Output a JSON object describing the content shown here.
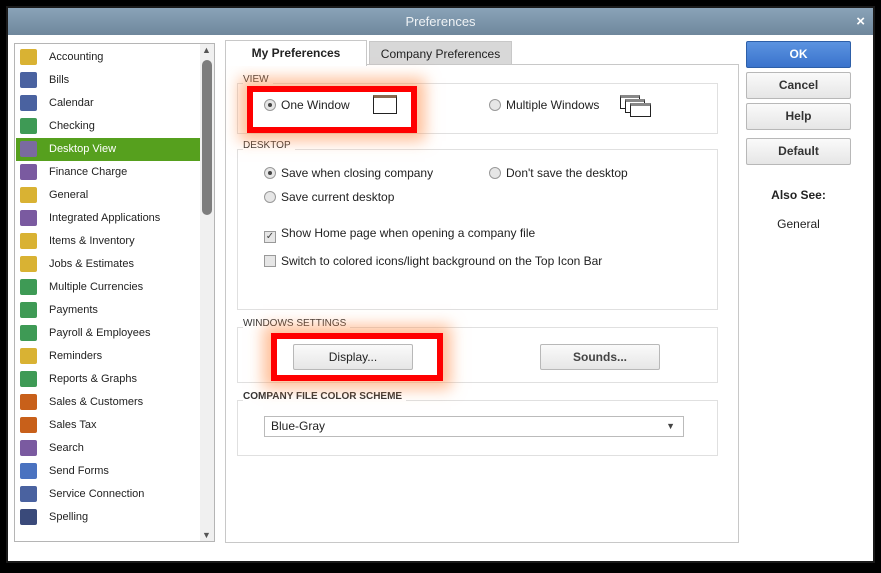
{
  "window": {
    "title": "Preferences",
    "close": "×"
  },
  "sidebar": {
    "items": [
      {
        "label": "Accounting",
        "icon": "accounting-icon",
        "color": "#d9b233"
      },
      {
        "label": "Bills",
        "icon": "bills-icon",
        "color": "#4a62a0"
      },
      {
        "label": "Calendar",
        "icon": "calendar-icon",
        "color": "#4a62a0"
      },
      {
        "label": "Checking",
        "icon": "checking-icon",
        "color": "#3e9a55"
      },
      {
        "label": "Desktop View",
        "icon": "desktop-view-icon",
        "color": "#7a6aa0",
        "selected": true
      },
      {
        "label": "Finance Charge",
        "icon": "finance-charge-icon",
        "color": "#7a5aa0"
      },
      {
        "label": "General",
        "icon": "general-icon",
        "color": "#d9b233"
      },
      {
        "label": "Integrated Applications",
        "icon": "integrated-apps-icon",
        "color": "#7a5aa0"
      },
      {
        "label": "Items & Inventory",
        "icon": "items-inventory-icon",
        "color": "#d9b233"
      },
      {
        "label": "Jobs & Estimates",
        "icon": "jobs-estimates-icon",
        "color": "#d9b233"
      },
      {
        "label": "Multiple Currencies",
        "icon": "currencies-icon",
        "color": "#3e9a55"
      },
      {
        "label": "Payments",
        "icon": "payments-icon",
        "color": "#3e9a55"
      },
      {
        "label": "Payroll & Employees",
        "icon": "payroll-icon",
        "color": "#3e9a55"
      },
      {
        "label": "Reminders",
        "icon": "reminders-icon",
        "color": "#d9b233"
      },
      {
        "label": "Reports & Graphs",
        "icon": "reports-graphs-icon",
        "color": "#3e9a55"
      },
      {
        "label": "Sales & Customers",
        "icon": "sales-customers-icon",
        "color": "#c8601a"
      },
      {
        "label": "Sales Tax",
        "icon": "sales-tax-icon",
        "color": "#c8601a"
      },
      {
        "label": "Search",
        "icon": "search-icon",
        "color": "#7a5aa0"
      },
      {
        "label": "Send Forms",
        "icon": "send-forms-icon",
        "color": "#4a72c0"
      },
      {
        "label": "Service Connection",
        "icon": "service-connection-icon",
        "color": "#4a62a0"
      },
      {
        "label": "Spelling",
        "icon": "spelling-icon",
        "color": "#3a4a7a"
      }
    ],
    "selected_color": "#56a01e"
  },
  "tabs": [
    {
      "label": "My Preferences",
      "active": true
    },
    {
      "label": "Company Preferences",
      "active": false
    }
  ],
  "view": {
    "heading": "VIEW",
    "one_window": "One Window",
    "multiple_windows": "Multiple Windows",
    "selected": "One Window"
  },
  "desktop": {
    "heading": "DESKTOP",
    "save_closing": "Save when closing company",
    "dont_save": "Don't save the desktop",
    "save_current": "Save current desktop",
    "selected": "Save when closing company",
    "show_home": {
      "label": "Show Home page when opening a company file",
      "checked": true
    },
    "colored_icons": {
      "label": "Switch to colored icons/light background on the Top Icon Bar",
      "checked": false
    }
  },
  "windows_settings": {
    "heading": "WINDOWS SETTINGS",
    "display": "Display...",
    "sounds": "Sounds..."
  },
  "color_scheme": {
    "heading": "COMPANY FILE COLOR SCHEME",
    "value": "Blue-Gray"
  },
  "buttons": {
    "ok": "OK",
    "cancel": "Cancel",
    "help": "Help",
    "default": "Default"
  },
  "also_see": {
    "heading": "Also See:",
    "link": "General"
  },
  "highlight_color": "#ff0000"
}
